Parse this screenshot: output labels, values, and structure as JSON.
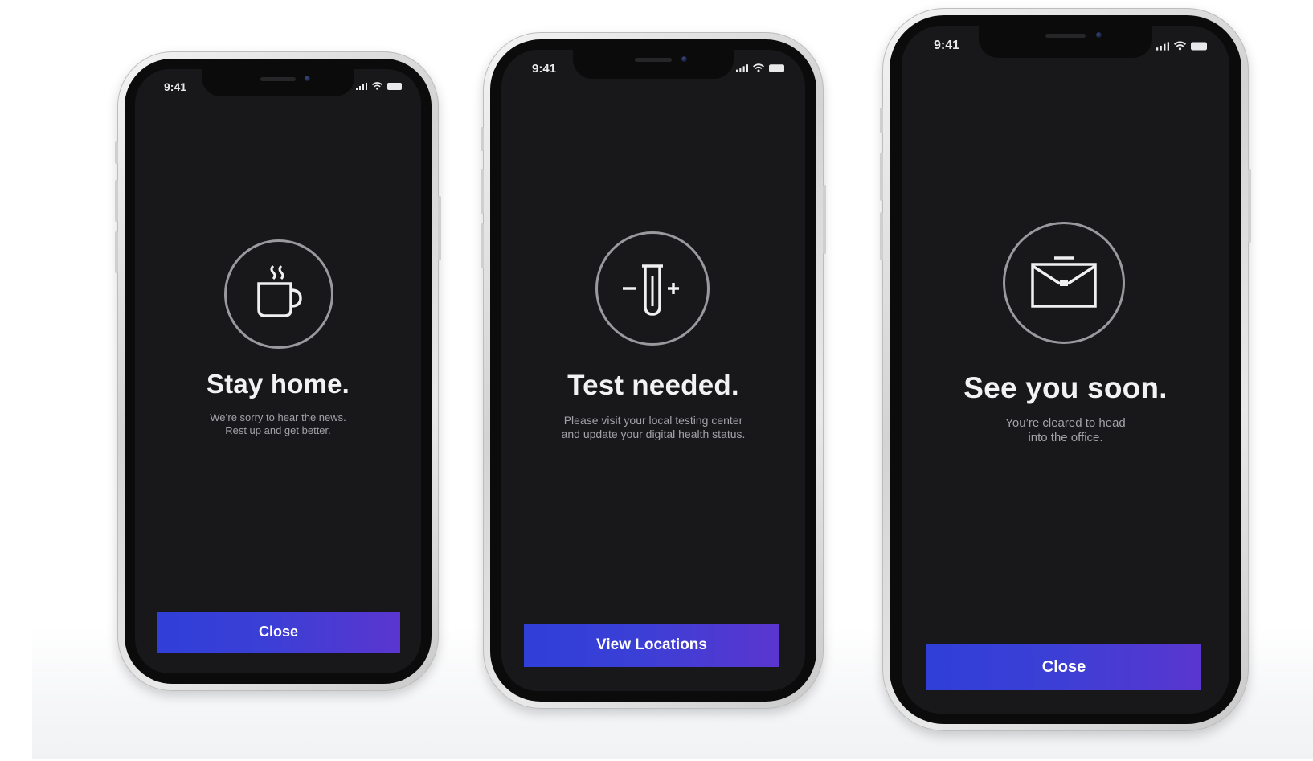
{
  "screens": [
    {
      "time": "9:41",
      "icon": "coffee-cup-icon",
      "title": "Stay home.",
      "subtitle_line1": "We’re sorry to hear the news.",
      "subtitle_line2": "Rest up and get better.",
      "button": "Close"
    },
    {
      "time": "9:41",
      "icon": "test-tube-icon",
      "title": "Test needed.",
      "subtitle_line1": "Please visit your local testing center",
      "subtitle_line2": "and update your digital health status.",
      "button": "View Locations"
    },
    {
      "time": "9:41",
      "icon": "briefcase-icon",
      "title": "See you soon.",
      "subtitle_line1": "You’re cleared to head",
      "subtitle_line2": "into the office.",
      "button": "Close"
    }
  ],
  "colors": {
    "screen_bg": "#18181b",
    "button_gradient_start": "#2f3fd8",
    "button_gradient_end": "#5a36cf",
    "title": "#f2f2f3",
    "subtitle": "#a2a2a7"
  }
}
